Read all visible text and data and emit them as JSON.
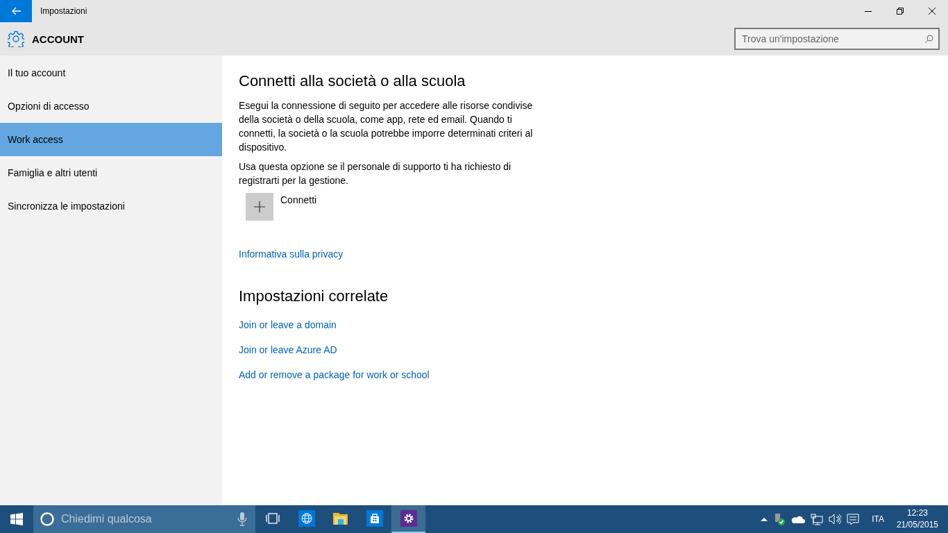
{
  "window": {
    "title": "Impostazioni"
  },
  "header": {
    "title": "ACCOUNT",
    "search": {
      "placeholder": "Trova un'impostazione"
    }
  },
  "sidebar": {
    "items": [
      {
        "label": "Il tuo account",
        "selected": false
      },
      {
        "label": "Opzioni di accesso",
        "selected": false
      },
      {
        "label": "Work access",
        "selected": true
      },
      {
        "label": "Famiglia e altri utenti",
        "selected": false
      },
      {
        "label": "Sincronizza le impostazioni",
        "selected": false
      }
    ]
  },
  "content": {
    "heading": "Connetti alla società o alla scuola",
    "paragraphs": [
      "Esegui la connessione di seguito per accedere alle risorse condivise della società o della scuola, come app, rete ed email. Quando ti connetti, la società o la scuola potrebbe imporre determinati criteri al dispositivo.",
      "Usa questa opzione se il personale di supporto ti ha richiesto di registrarti per la gestione."
    ],
    "connect_button": "Connetti",
    "privacy_link": "Informativa sulla privacy",
    "related": {
      "heading": "Impostazioni correlate",
      "links": [
        "Join or leave a domain",
        "Join or leave Azure AD",
        "Add or remove a package for work or school"
      ]
    }
  },
  "taskbar": {
    "search": {
      "placeholder": "Chiedimi qualcosa"
    },
    "apps": [
      {
        "kind": "taskview",
        "selected": false
      },
      {
        "kind": "globe",
        "selected": false
      },
      {
        "kind": "explorer",
        "selected": false
      },
      {
        "kind": "store",
        "selected": false
      },
      {
        "kind": "settings",
        "selected": true
      }
    ],
    "tray": {
      "language": "ITA",
      "time": "12:23",
      "date": "21/05/2015"
    }
  }
}
